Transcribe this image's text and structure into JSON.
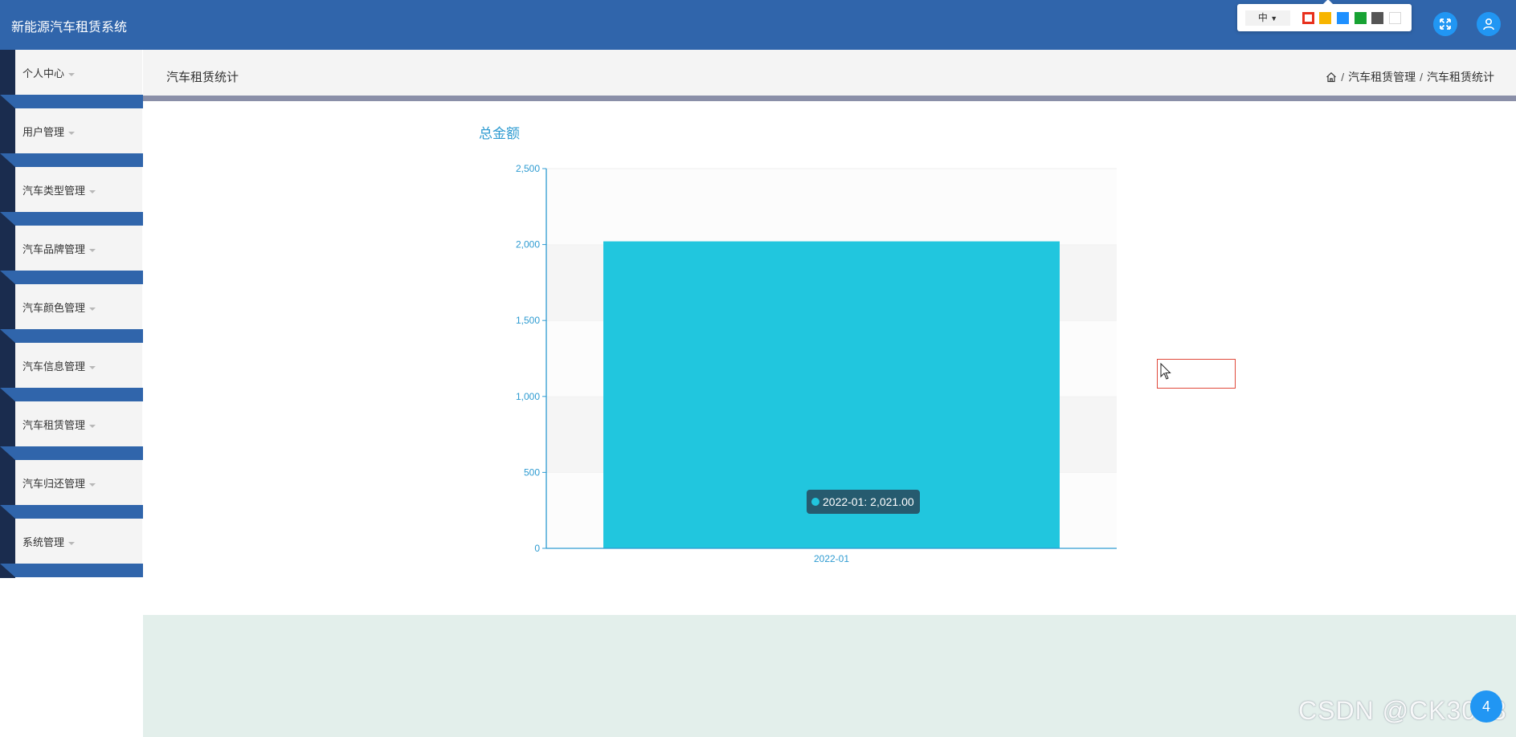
{
  "header": {
    "app_title": "新能源汽车租赁系统",
    "lang_label": "中",
    "theme_colors": [
      "#e8301c",
      "#f7b500",
      "#1e90ff",
      "#17a233",
      "#555555",
      "#ffffff"
    ]
  },
  "sidebar": {
    "items": [
      {
        "label": "个人中心"
      },
      {
        "label": "用户管理"
      },
      {
        "label": "汽车类型管理"
      },
      {
        "label": "汽车品牌管理"
      },
      {
        "label": "汽车颜色管理"
      },
      {
        "label": "汽车信息管理"
      },
      {
        "label": "汽车租赁管理"
      },
      {
        "label": "汽车归还管理"
      },
      {
        "label": "系统管理"
      }
    ]
  },
  "page": {
    "title": "汽车租赁统计",
    "breadcrumb": [
      "汽车租赁管理",
      "汽车租赁统计"
    ]
  },
  "chart_data": {
    "type": "bar",
    "title": "总金额",
    "categories": [
      "2022-01"
    ],
    "values": [
      2021
    ],
    "ylim": [
      0,
      2500
    ],
    "yticks": [
      "0",
      "500",
      "1,000",
      "1,500",
      "2,000",
      "2,500"
    ],
    "grid": "alternating horizontal bands",
    "bar_color": "#21c6de",
    "axis_color": "#2e9bd1",
    "tooltip": "2022-01: 2,021.00"
  },
  "watermark": "CSDN @CK3043",
  "float_button": "4"
}
